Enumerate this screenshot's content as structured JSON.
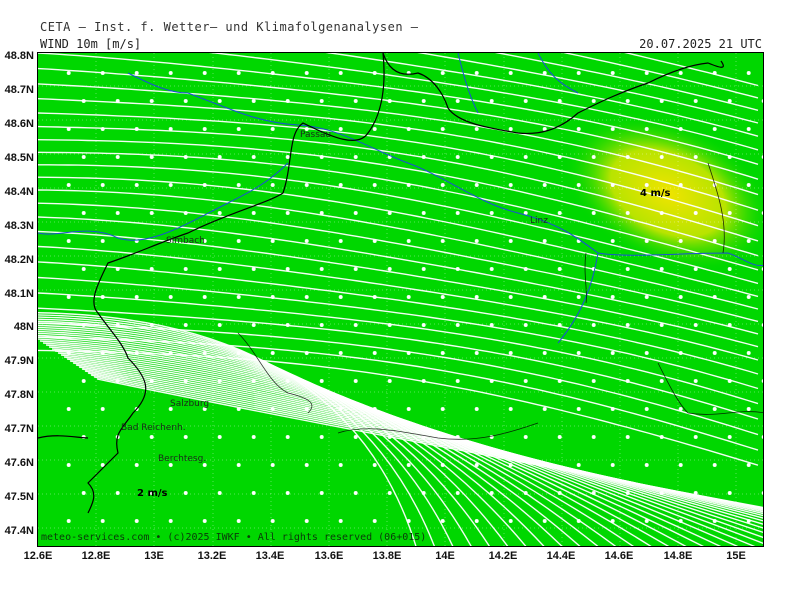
{
  "title": "CETA — Inst. f. Wetter— und Klimafolgenanalysen —",
  "header": {
    "left": "WIND 10m [m/s]",
    "right": "20.07.2025 21 UTC"
  },
  "lat_labels": [
    "48.8N",
    "48.7N",
    "48.6N",
    "48.5N",
    "48.4N",
    "48.3N",
    "48.2N",
    "48.1N",
    "48N",
    "47.9N",
    "47.8N",
    "47.7N",
    "47.6N",
    "47.5N",
    "47.4N"
  ],
  "lon_labels": [
    "12.6E",
    "12.8E",
    "13E",
    "13.2E",
    "13.4E",
    "13.6E",
    "13.8E",
    "14E",
    "14.2E",
    "14.4E",
    "14.6E",
    "14.8E",
    "15E"
  ],
  "places": {
    "passau": "Passau",
    "linz": "Linz",
    "simbach": "Simbach",
    "salzburg": "Salzburg",
    "bad_reichenhall": "Bad Reichenh.",
    "berchtesgaden": "Berchtesg."
  },
  "speed_labels": {
    "high": "4 m/s",
    "low": "2 m/s"
  },
  "footer": "meteo-services.com • (c)2025 IWKF • All rights reserved (06+015)",
  "colors": {
    "field": "#00d700",
    "field_high": "#e8e000",
    "streamline": "#ffffff",
    "border": "#000000",
    "river": "#1a4fd6"
  }
}
